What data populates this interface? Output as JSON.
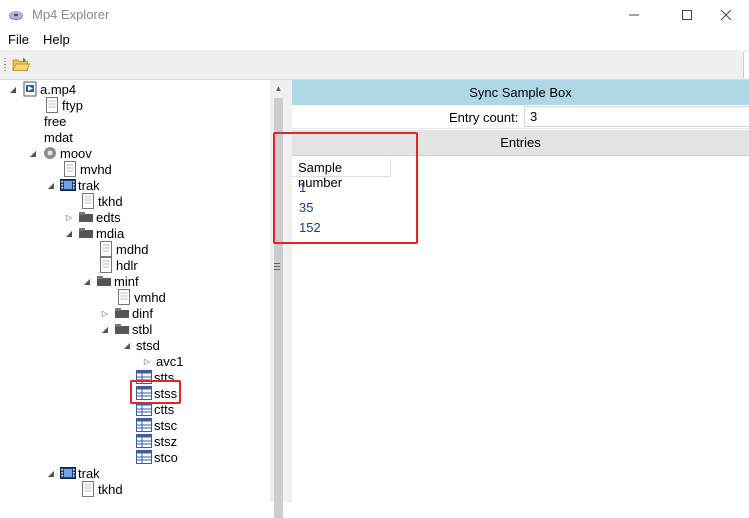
{
  "window": {
    "title": "Mp4 Explorer"
  },
  "menu": {
    "file": "File",
    "help": "Help"
  },
  "colors": {
    "header_bg": "#add8e6",
    "highlight": "#e0262b",
    "link_blue": "#1a3e8c"
  },
  "tree": {
    "root": "a.mp4",
    "ftyp": "ftyp",
    "free": "free",
    "mdat": "mdat",
    "moov": "moov",
    "mvhd": "mvhd",
    "trak1": "trak",
    "tkhd1": "tkhd",
    "edts": "edts",
    "mdia": "mdia",
    "mdhd": "mdhd",
    "hdlr": "hdlr",
    "minf": "minf",
    "vmhd": "vmhd",
    "dinf": "dinf",
    "stbl": "stbl",
    "stsd": "stsd",
    "avc1": "avc1",
    "stts": "stts",
    "stss": "stss",
    "ctts": "ctts",
    "stsc": "stsc",
    "stsz": "stsz",
    "stco": "stco",
    "trak2": "trak",
    "tkhd2": "tkhd"
  },
  "detail": {
    "box_title": "Sync Sample Box",
    "entry_count_label": "Entry count:",
    "entry_count_value": "3",
    "entries_title": "Entries",
    "column_header": "Sample number",
    "rows": [
      "1",
      "35",
      "152"
    ]
  }
}
